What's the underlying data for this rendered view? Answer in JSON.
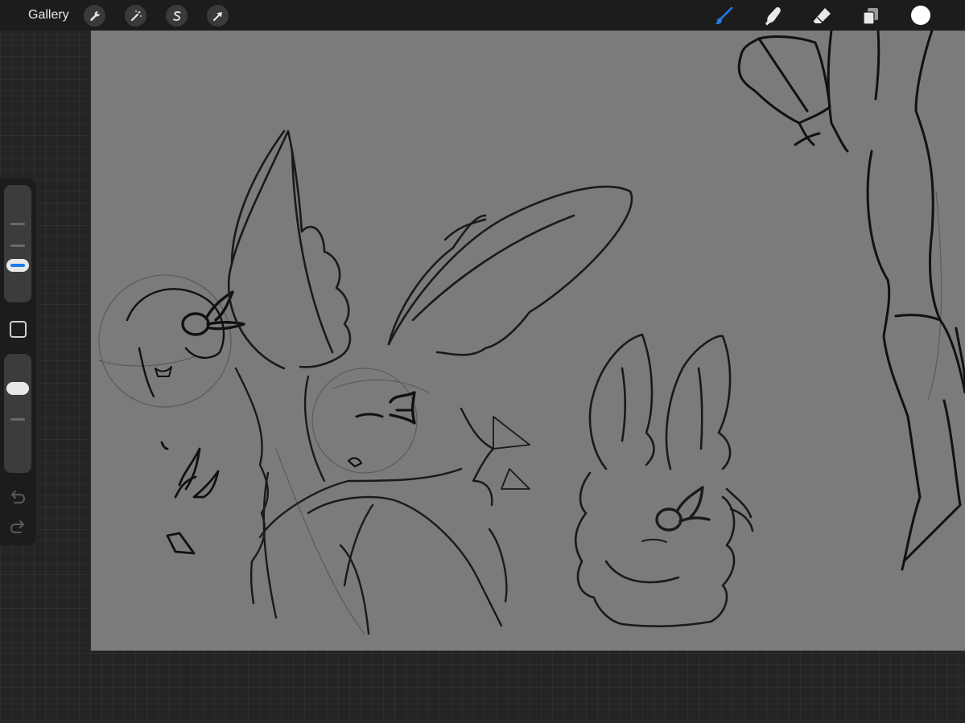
{
  "toolbar": {
    "gallery_label": "Gallery",
    "left_tools": [
      {
        "name": "actions",
        "icon": "wrench-icon"
      },
      {
        "name": "adjustments",
        "icon": "magic-wand-icon"
      },
      {
        "name": "selection",
        "icon": "selection-s-icon"
      },
      {
        "name": "transform",
        "icon": "arrow-cursor-icon"
      }
    ],
    "right_tools": [
      {
        "name": "brush",
        "icon": "brush-icon",
        "active": true
      },
      {
        "name": "smudge",
        "icon": "smudge-finger-icon",
        "active": false
      },
      {
        "name": "eraser",
        "icon": "eraser-icon",
        "active": false
      },
      {
        "name": "layers",
        "icon": "layers-icon",
        "active": false
      }
    ],
    "current_color": "#ffffff"
  },
  "sidebar": {
    "brush_size_slider": {
      "icon": "size-slider",
      "level": 0.7
    },
    "opacity_slider": {
      "icon": "opacity-slider",
      "level": 0.75
    },
    "modify_button": "square-modify-icon",
    "undo": "undo-icon",
    "redo": "redo-icon"
  },
  "colors": {
    "toolbar_bg": "#1c1c1c",
    "workspace_bg": "#242424",
    "canvas_bg": "#7b7b7b",
    "accent_blue": "#1e7cf0",
    "sketch_line": "#111111"
  }
}
